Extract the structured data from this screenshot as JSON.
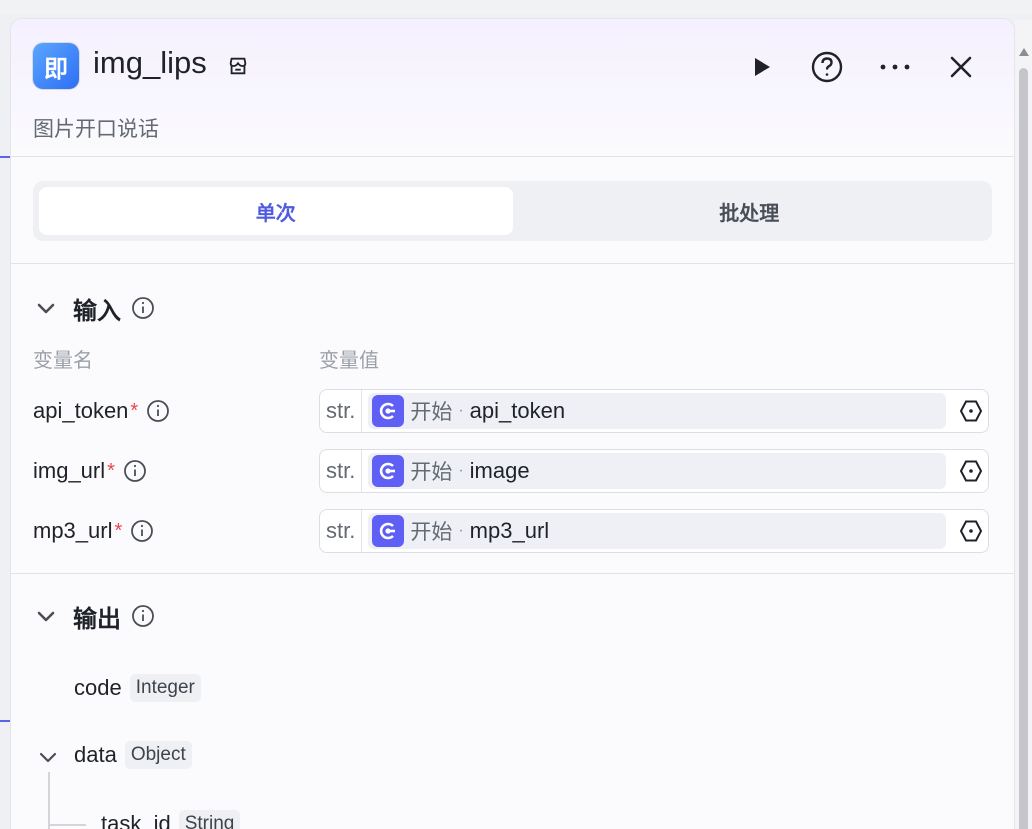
{
  "header": {
    "app_icon_char": "即",
    "title": "img_lips",
    "subtitle": "图片开口说话",
    "icons": [
      "store-icon",
      "play-icon",
      "help-icon",
      "more-icon",
      "close-icon"
    ]
  },
  "tabs": [
    {
      "label": "单次",
      "active": true
    },
    {
      "label": "批处理",
      "active": false
    }
  ],
  "input": {
    "title": "输入",
    "col_name": "变量名",
    "col_value": "变量值",
    "rows": [
      {
        "name": "api_token",
        "required": "*",
        "type": "str.",
        "node": "开始",
        "sep": "·",
        "var": "api_token"
      },
      {
        "name": "img_url",
        "required": "*",
        "type": "str.",
        "node": "开始",
        "sep": "·",
        "var": "image"
      },
      {
        "name": "mp3_url",
        "required": "*",
        "type": "str.",
        "node": "开始",
        "sep": "·",
        "var": "mp3_url"
      }
    ]
  },
  "output": {
    "title": "输出",
    "items": [
      {
        "name": "code",
        "type": "Integer"
      },
      {
        "name": "data",
        "type": "Object"
      },
      {
        "name": "task_id",
        "type": "String"
      }
    ]
  },
  "colors": {
    "accent": "#4f5be0",
    "chip_icon": "#5f5ff6",
    "required": "#e5484d"
  }
}
